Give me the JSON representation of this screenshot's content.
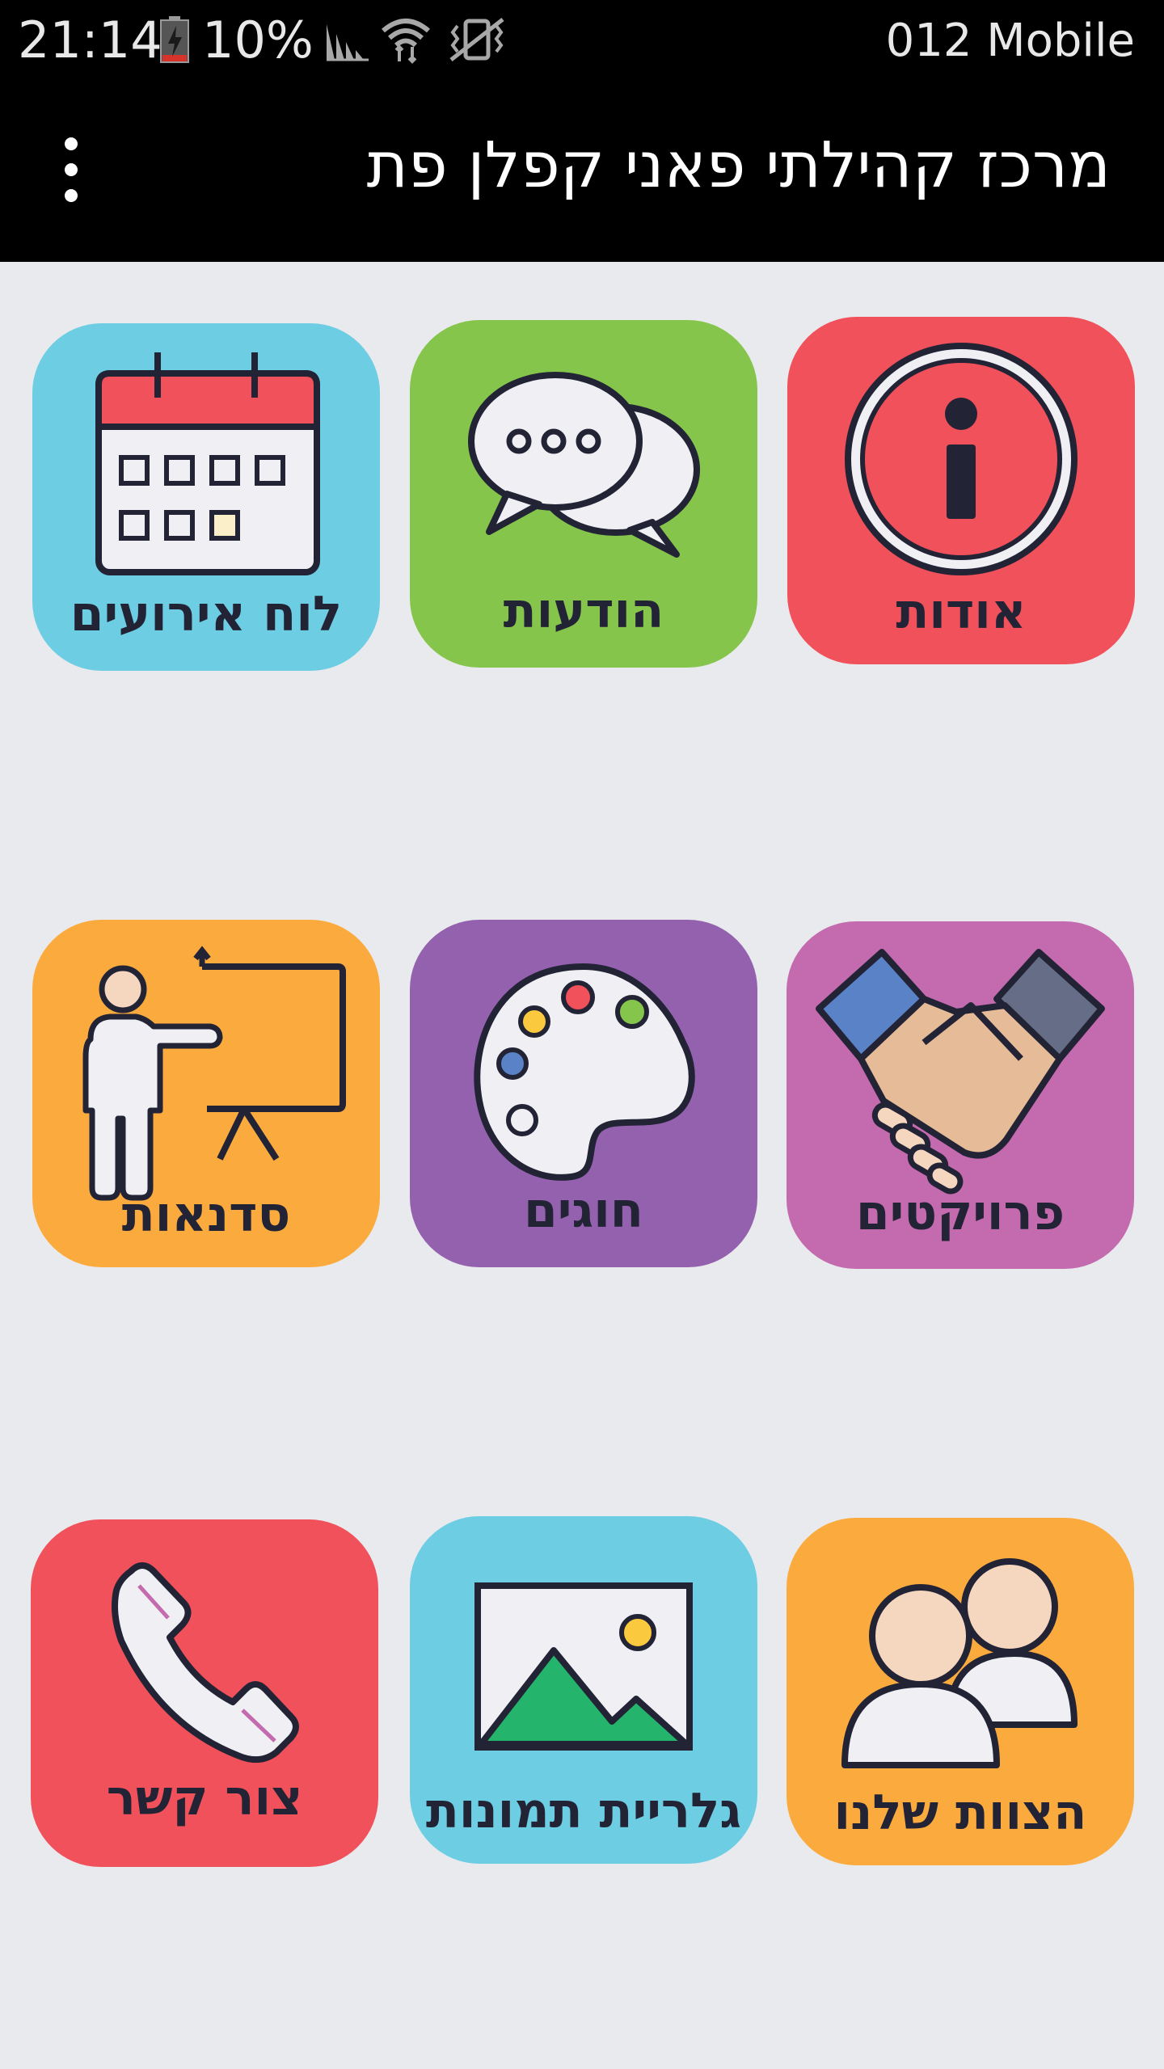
{
  "status_bar": {
    "time": "21:14",
    "battery_percent": "10%",
    "carrier": "012 Mobile"
  },
  "app_bar": {
    "title": "מרכז קהילתי פאני קפלן פת",
    "menu_icon": "more-vert-icon"
  },
  "colors": {
    "background": "#e9eaee",
    "red": "#f0515a",
    "green": "#86c54c",
    "blue": "#6dcde3",
    "orange": "#fbab3e",
    "purple": "#9361ad",
    "pink": "#c46aaf",
    "ink": "#232336"
  },
  "tiles": [
    {
      "label": "אודות",
      "icon": "info-icon"
    },
    {
      "label": "הודעות",
      "icon": "chat-bubbles-icon"
    },
    {
      "label": "לוח אירועים",
      "icon": "calendar-icon"
    },
    {
      "label": "פרויקטים",
      "icon": "handshake-icon"
    },
    {
      "label": "חוגים",
      "icon": "palette-icon"
    },
    {
      "label": "סדנאות",
      "icon": "presentation-icon"
    },
    {
      "label": "הצוות שלנו",
      "icon": "team-icon"
    },
    {
      "label": "גלריית תמונות",
      "icon": "gallery-icon"
    },
    {
      "label": "צור קשר",
      "icon": "phone-icon"
    }
  ]
}
